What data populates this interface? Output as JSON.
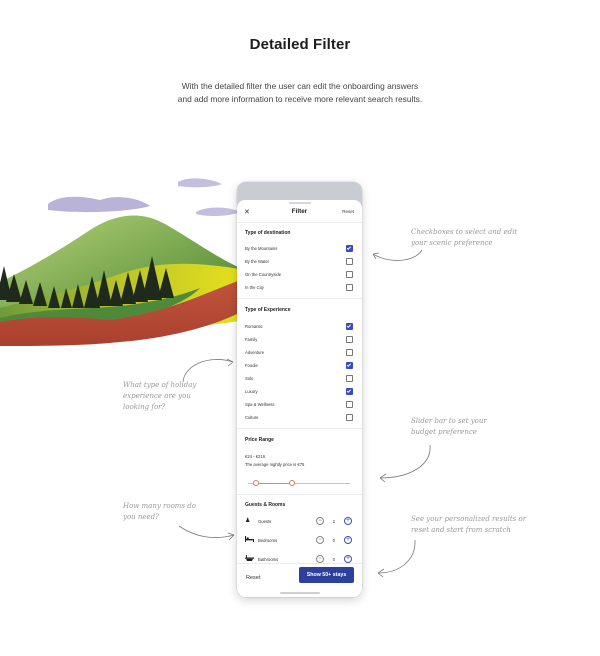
{
  "page": {
    "title": "Detailed Filter",
    "subtitle": "With the detailed filter the user can edit the onboarding answers and add more information to receive more relevant search results."
  },
  "annotations": {
    "checkboxes": "Checkboxes to select and edit your scenic preference",
    "experience": "What type of holiday experience are you looking for?",
    "slider": "Slider bar to set your budget preference",
    "rooms": "How many rooms do you need?",
    "results": "See your personalized results or reset and start from scratch"
  },
  "filter": {
    "close_icon": "close-icon",
    "title": "Filter",
    "reset_top": "Reset",
    "destination": {
      "title": "Type of destination",
      "options": [
        {
          "label": "By the Mountains",
          "checked": true
        },
        {
          "label": "By the Water",
          "checked": false
        },
        {
          "label": "On the Countryside",
          "checked": false
        },
        {
          "label": "In the City",
          "checked": false
        }
      ]
    },
    "experience": {
      "title": "Type of Experience",
      "options": [
        {
          "label": "Romantic",
          "checked": true
        },
        {
          "label": "Family",
          "checked": false
        },
        {
          "label": "Adventure",
          "checked": false
        },
        {
          "label": "Foodie",
          "checked": true
        },
        {
          "label": "Solo",
          "checked": false
        },
        {
          "label": "Luxury",
          "checked": true
        },
        {
          "label": "Spa & Wellness",
          "checked": false
        },
        {
          "label": "Culture",
          "checked": false
        }
      ]
    },
    "price": {
      "title": "Price Range",
      "range": "€24 - €216",
      "average": "The average nightly price is €75"
    },
    "guests": {
      "title": "Guests & Rooms",
      "rows": [
        {
          "label": "Guests",
          "count": "2",
          "icon": "person-icon"
        },
        {
          "label": "Bedrooms",
          "count": "0",
          "icon": "bed-icon"
        },
        {
          "label": "Bathrooms",
          "count": "0",
          "icon": "bathtub-icon"
        }
      ],
      "minus": "−",
      "plus": "+"
    },
    "footer": {
      "reset": "Reset",
      "show": "Show 50+ stays"
    }
  },
  "colors": {
    "accent": "#2f3f9e",
    "checkbox": "#3b4cb8",
    "slider": "#e07a5c"
  }
}
